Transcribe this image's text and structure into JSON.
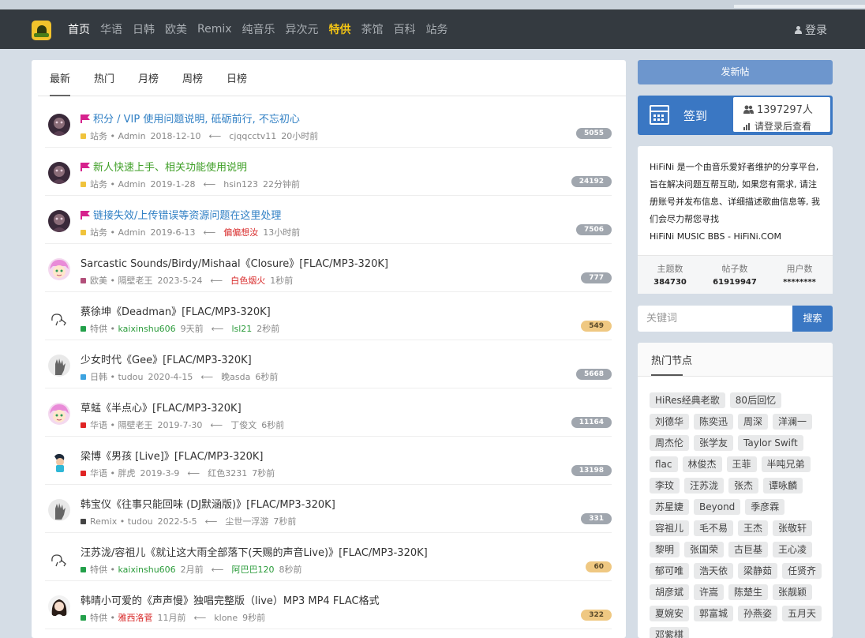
{
  "colors": {
    "nav_bg": "#343a40",
    "accent": "#3a77c3",
    "special": "#f4c514",
    "badge_grey": "#a0a6ae",
    "badge_orange": "#efc882"
  },
  "nav": {
    "logo_icon": "hifini-logo-icon",
    "items": [
      "首页",
      "华语",
      "日韩",
      "欧美",
      "Remix",
      "纯音乐",
      "异次元",
      "特供",
      "茶馆",
      "百科",
      "站务"
    ],
    "active": "首页",
    "special": "特供",
    "login": "登录"
  },
  "tabs": [
    "最新",
    "热门",
    "月榜",
    "周榜",
    "日榜"
  ],
  "threads": [
    {
      "title": "积分 / VIP 使用问题说明, 砥砺前行, 不忘初心",
      "pinned": true,
      "title_color": "blue",
      "forum": "站务",
      "forum_color": "#f0c33c",
      "author": "Admin",
      "date": "2018-12-10",
      "last_user": "cjqqcctv11",
      "last_time": "20小时前",
      "replies": "5055"
    },
    {
      "title": "新人快速上手、相关功能使用说明",
      "pinned": true,
      "title_color": "green",
      "forum": "站务",
      "forum_color": "#f0c33c",
      "author": "Admin",
      "date": "2019-1-28",
      "last_user": "hsin123",
      "last_time": "22分钟前",
      "replies": "24192"
    },
    {
      "title": "链接失效/上传错误等资源问题在这里处理",
      "pinned": true,
      "title_color": "blue",
      "forum": "站务",
      "forum_color": "#f0c33c",
      "author": "Admin",
      "date": "2019-6-13",
      "last_user": "偏偏想汝",
      "last_user_style": "red",
      "last_time": "13小时前",
      "replies": "7506"
    },
    {
      "title": "Sarcastic Sounds/Birdy/Mishaal《Closure》[FLAC/MP3-320K]",
      "forum": "欧美",
      "forum_color": "#b24f7a",
      "author": "隔壁老王",
      "date": "2023-5-24",
      "last_user": "白色烟火",
      "last_user_style": "red",
      "last_time": "1秒前",
      "replies": "777"
    },
    {
      "title": "蔡徐坤《Deadman》[FLAC/MP3-320K]",
      "forum": "特供",
      "forum_color": "#23a04a",
      "author": "kaixinshu606",
      "author_style": "green",
      "date": "9天前",
      "last_user": "lsl21",
      "last_user_style": "green",
      "last_time": "2秒前",
      "replies": "549",
      "badge": "orange"
    },
    {
      "title": "少女时代《Gee》[FLAC/MP3-320K]",
      "forum": "日韩",
      "forum_color": "#3da3e0",
      "author": "tudou",
      "date": "2020-4-15",
      "last_user": "晚asda",
      "last_time": "6秒前",
      "replies": "5668"
    },
    {
      "title": "草蜢《半点心》[FLAC/MP3-320K]",
      "forum": "华语",
      "forum_color": "#e02424",
      "author": "隔壁老王",
      "date": "2019-7-30",
      "last_user": "丁俊文",
      "last_time": "6秒前",
      "replies": "11164"
    },
    {
      "title": "梁博《男孩 [Live]》[FLAC/MP3-320K]",
      "forum": "华语",
      "forum_color": "#e02424",
      "author": "胖虎",
      "date": "2019-3-9",
      "last_user": "红色3231",
      "last_time": "7秒前",
      "replies": "13198"
    },
    {
      "title": "韩宝仪《往事只能回味 (DJ默涵版)》[FLAC/MP3-320K]",
      "forum": "Remix",
      "forum_color": "#444444",
      "author": "tudou",
      "date": "2022-5-5",
      "last_user": "尘世一浮游",
      "last_time": "7秒前",
      "replies": "331"
    },
    {
      "title": "汪苏泷/容祖儿《就让这大雨全部落下(天赐的声音Live)》[FLAC/MP3-320K]",
      "forum": "特供",
      "forum_color": "#23a04a",
      "author": "kaixinshu606",
      "author_style": "green",
      "date": "2月前",
      "last_user": "阿巴巴120",
      "last_user_style": "green",
      "last_time": "8秒前",
      "replies": "60",
      "badge": "orange"
    },
    {
      "title": "韩晴小可爱的《声声慢》独唱完整版（live）MP3 MP4 FLAC格式",
      "forum": "特供",
      "forum_color": "#23a04a",
      "author": "雅西洛菅",
      "author_style": "red",
      "date": "11月前",
      "last_user": "klone",
      "last_time": "9秒前",
      "replies": "322",
      "badge": "orange"
    }
  ],
  "sidebar": {
    "post_button": "发新帖",
    "signin": {
      "label": "签到",
      "count": "1397297人",
      "check": "请登录后查看"
    },
    "about": {
      "lines": [
        "HiFiNi 是一个由音乐爱好者维护的分享平台,",
        "旨在解决问题互帮互助, 如果您有需求, 请注",
        "册账号并发布信息、详细描述歌曲信息等, 我",
        "们会尽力帮您寻找",
        "HiFiNi MUSIC BBS - HiFiNi.COM"
      ],
      "stats": [
        {
          "label": "主题数",
          "value": "384730"
        },
        {
          "label": "帖子数",
          "value": "61919947"
        },
        {
          "label": "用户数",
          "value": "********"
        }
      ]
    },
    "search": {
      "placeholder": "关键词",
      "button": "搜索"
    },
    "hot": {
      "title": "热门节点",
      "tags": [
        "HiRes经典老歌",
        "80后回忆",
        "刘德华",
        "陈奕迅",
        "周深",
        "洋澜一",
        "周杰伦",
        "张学友",
        "Taylor Swift",
        "flac",
        "林俊杰",
        "王菲",
        "半吨兄弟",
        "李玟",
        "汪苏泷",
        "张杰",
        "谭咏麟",
        "苏星婕",
        "Beyond",
        "季彦霖",
        "容祖儿",
        "毛不易",
        "王杰",
        "张敬轩",
        "黎明",
        "张国荣",
        "古巨基",
        "王心凌",
        "郁可唯",
        "浩天依",
        "梁静茹",
        "任贤齐",
        "胡彦斌",
        "许嵩",
        "陈楚生",
        "张靓颖",
        "夏婉安",
        "郭富城",
        "孙燕姿",
        "五月天",
        "邓紫棋"
      ]
    }
  }
}
